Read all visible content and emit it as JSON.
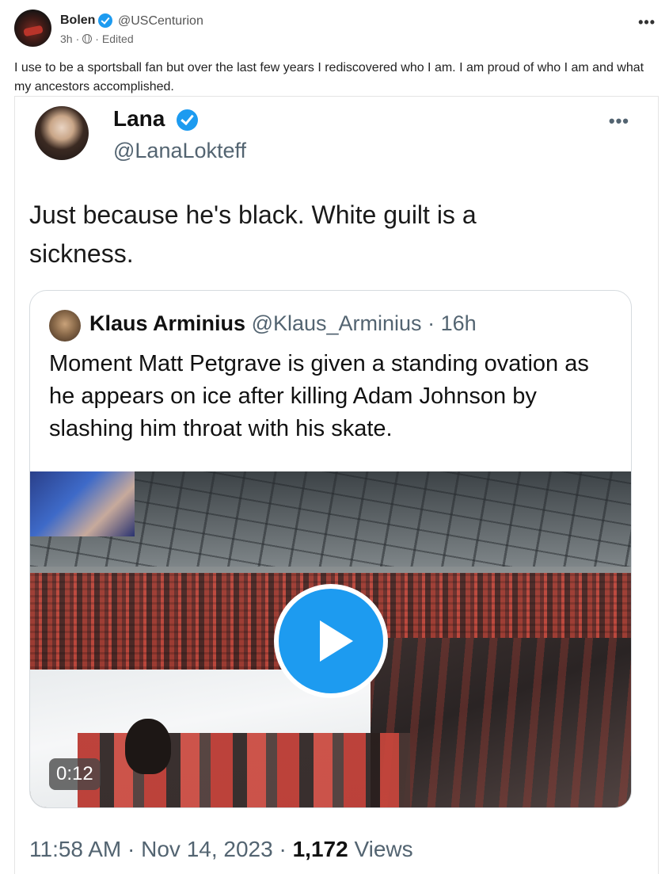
{
  "post": {
    "author_name": "Bolen",
    "author_handle": "@USCenturion",
    "time": "3h",
    "edited": "Edited",
    "body": "I use to be a sportsball fan but over the last few years I rediscovered who I am. I am proud of who I am and what my ancestors accomplished.",
    "more_icon": "more-horizontal-icon",
    "colors": {
      "verified": "#1d9bf0"
    }
  },
  "tweet": {
    "name": "Lana",
    "handle": "@LanaLokteff",
    "text": "Just because he's black. White guilt is a sickness.",
    "quoted": {
      "name": "Klaus Arminius",
      "handle": "@Klaus_Arminius",
      "age": "16h",
      "text": "Moment Matt Petgrave is given a standing ovation as he appears on ice after killing Adam Johnson by slashing him throat with his skate.",
      "video_duration": "0:12"
    },
    "time": "11:58 AM",
    "date": "Nov 14, 2023",
    "views_count": "1,172",
    "views_label": "Views"
  }
}
